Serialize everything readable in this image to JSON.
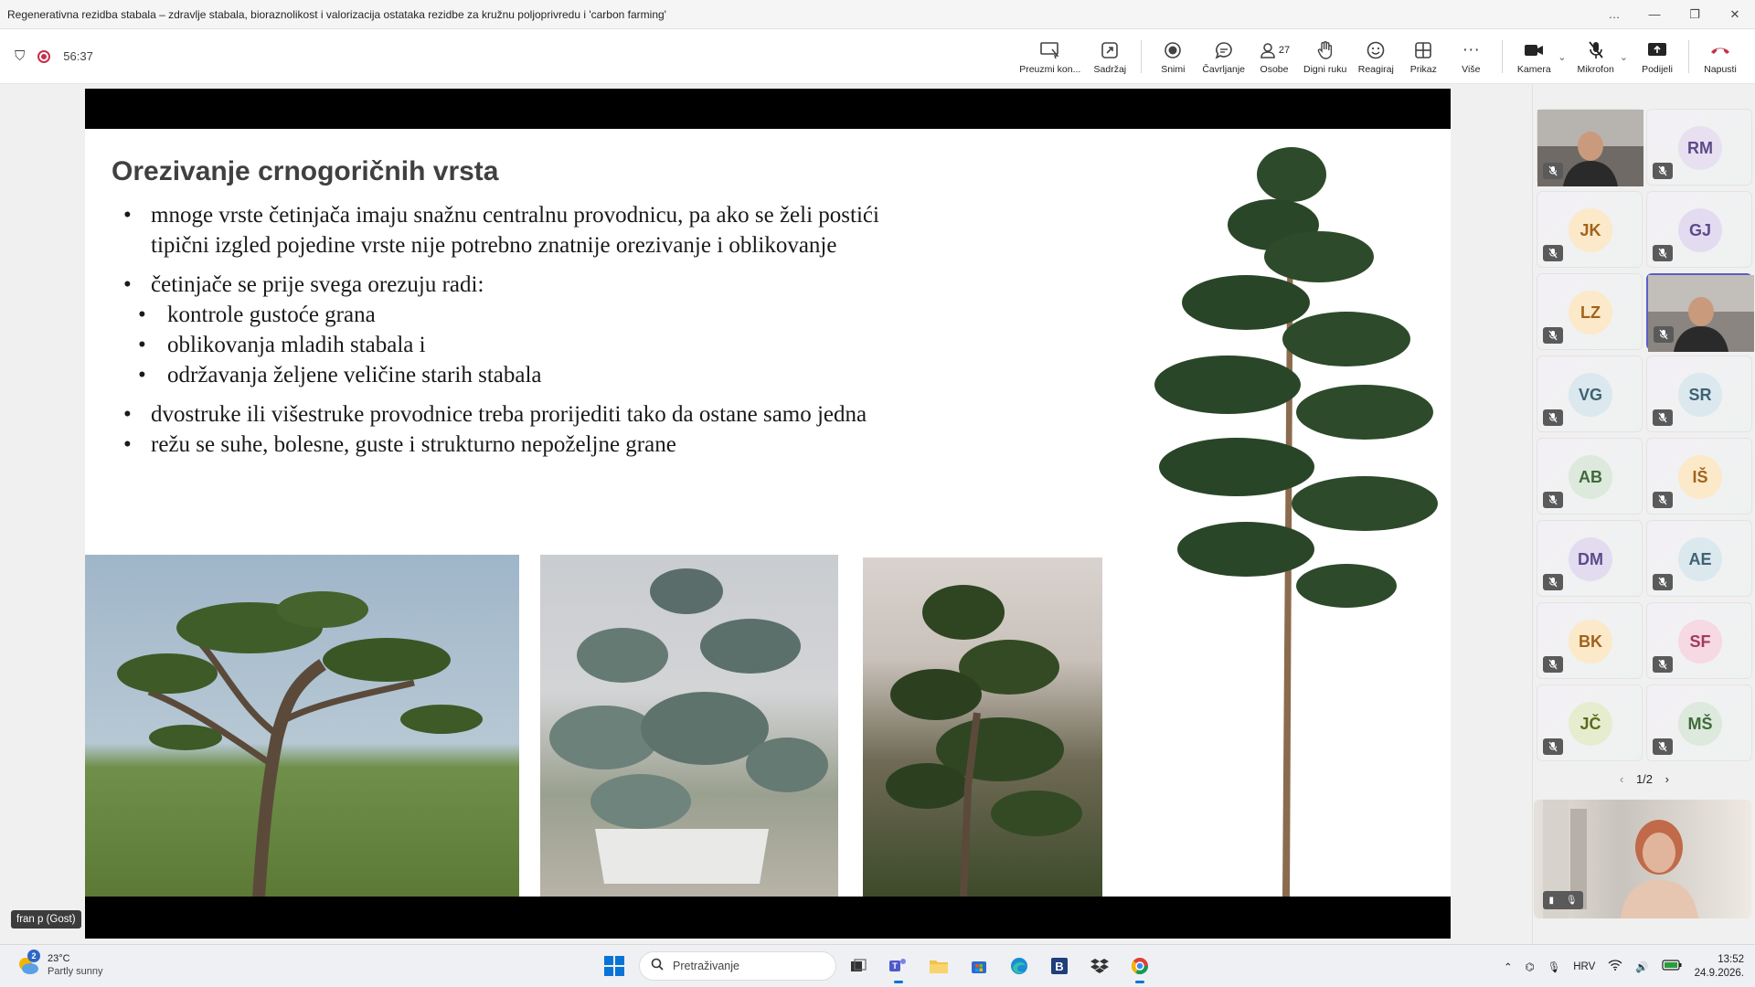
{
  "window": {
    "title": "Regenerativna rezidba stabala – zdravlje stabala, bioraznolikost i valorizacija ostataka rezidbe za kružnu poljoprivredu i 'carbon farming'",
    "controls": [
      "…",
      "—",
      "❐",
      "✕"
    ]
  },
  "meeting": {
    "timer": "56:37",
    "toolbar": [
      {
        "id": "take-control",
        "label": "Preuzmi kon...",
        "icon": "take-control-icon"
      },
      {
        "id": "content",
        "label": "Sadržaj",
        "icon": "share-content-icon"
      },
      {
        "id": "record",
        "label": "Snimi",
        "icon": "record-icon"
      },
      {
        "id": "chat",
        "label": "Čavrljanje",
        "icon": "chat-icon"
      },
      {
        "id": "people",
        "label": "Osobe",
        "icon": "people-icon",
        "count": "27"
      },
      {
        "id": "raise-hand",
        "label": "Digni ruku",
        "icon": "raise-hand-icon"
      },
      {
        "id": "react",
        "label": "Reagiraj",
        "icon": "emoji-icon"
      },
      {
        "id": "view",
        "label": "Prikaz",
        "icon": "grid-view-icon"
      },
      {
        "id": "more",
        "label": "Više",
        "icon": "more-icon"
      },
      {
        "id": "camera",
        "label": "Kamera",
        "icon": "camera-icon"
      },
      {
        "id": "mic",
        "label": "Mikrofon",
        "icon": "mic-off-icon"
      },
      {
        "id": "share",
        "label": "Podijeli",
        "icon": "share-icon"
      },
      {
        "id": "leave",
        "label": "Napusti",
        "icon": "hang-up-icon"
      }
    ]
  },
  "slide": {
    "heading": "Orezivanje crnogoričnih vrsta",
    "bullets": [
      "mnoge vrste četinjača imaju snažnu centralnu provodnicu, pa ako se želi postići tipični izgled pojedine vrste nije potrebno znatnije orezivanje i oblikovanje",
      "četinjače se prije svega orezuju radi:",
      "kontrole gustoće grana",
      "oblikovanja mladih stabala i",
      "održavanja željene veličine starih stabala",
      "dvostruke ili višestruke provodnice treba prorijediti tako da ostane samo jedna",
      "režu se suhe, bolesne, guste i strukturno nepoželjne grane"
    ]
  },
  "participants": {
    "tiles": [
      {
        "initials": "",
        "video": true,
        "color": "#6f6a66"
      },
      {
        "initials": "RM",
        "bg": "#e8e0f0",
        "fg": "#5b4b8a"
      },
      {
        "initials": "JK",
        "bg": "#fbe9c9",
        "fg": "#a0631b"
      },
      {
        "initials": "GJ",
        "bg": "#e3dcf1",
        "fg": "#5b4b8a"
      },
      {
        "initials": "LZ",
        "bg": "#fbe9c9",
        "fg": "#a0631b"
      },
      {
        "initials": "",
        "video": true,
        "active": true,
        "color": "#8a8580"
      },
      {
        "initials": "VG",
        "bg": "#dbe8ee",
        "fg": "#3d6373"
      },
      {
        "initials": "SR",
        "bg": "#dbe8ee",
        "fg": "#3d6373"
      },
      {
        "initials": "AB",
        "bg": "#dde9dc",
        "fg": "#3f6b3c"
      },
      {
        "initials": "IŠ",
        "bg": "#fbe9c9",
        "fg": "#a0631b"
      },
      {
        "initials": "DM",
        "bg": "#e3dcf1",
        "fg": "#5b4b8a"
      },
      {
        "initials": "AE",
        "bg": "#dbe8ee",
        "fg": "#3d6373"
      },
      {
        "initials": "BK",
        "bg": "#fbe9c9",
        "fg": "#a0631b"
      },
      {
        "initials": "SF",
        "bg": "#f6d9e2",
        "fg": "#a33a5c"
      },
      {
        "initials": "JČ",
        "bg": "#e6edcf",
        "fg": "#5c6a1c"
      },
      {
        "initials": "MŠ",
        "bg": "#dde9dc",
        "fg": "#3f6b3c"
      }
    ],
    "pager": "1/2"
  },
  "guest_label": "fran p (Gost)",
  "taskbar": {
    "weather_badge": "2",
    "temperature": "23°C",
    "condition": "Partly sunny",
    "search_placeholder": "Pretraživanje",
    "language": "HRV",
    "time": "13:52",
    "date": "24.9.2026."
  }
}
